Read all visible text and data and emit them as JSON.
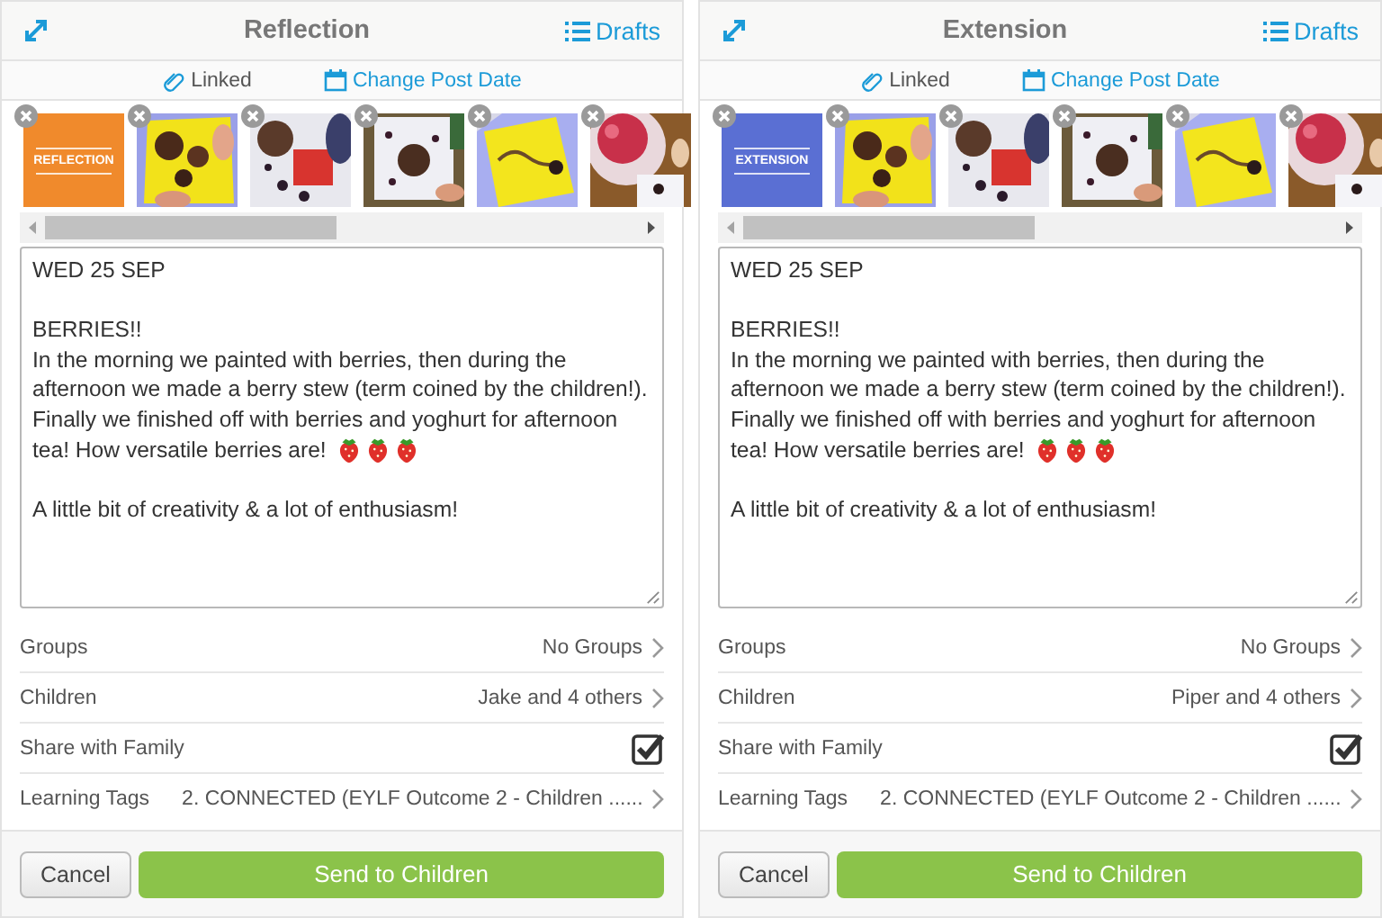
{
  "panels": [
    {
      "header": {
        "title": "Reflection",
        "drafts": "Drafts"
      },
      "toolbar": {
        "linked": "Linked",
        "change_date": "Change Post Date"
      },
      "thumbnails": [
        {
          "kind": "cover",
          "label": "REFLECTION",
          "color": "#f08a2c"
        },
        {
          "kind": "picture"
        },
        {
          "kind": "picture"
        },
        {
          "kind": "picture"
        },
        {
          "kind": "picture"
        },
        {
          "kind": "picture"
        }
      ],
      "body": [
        {
          "kind": "text",
          "text": "WED 25 SEP"
        },
        {
          "kind": "blank"
        },
        {
          "kind": "text",
          "text": "BERRIES!!"
        },
        {
          "kind": "text",
          "text": "In the morning we painted with berries, then during the"
        },
        {
          "kind": "text",
          "text": "afternoon we made a berry stew (term coined by the children!)."
        },
        {
          "kind": "text",
          "text": "Finally we finished off with berries and yoghurt for afternoon"
        },
        {
          "kind": "text",
          "text": "tea! How versatile berries are!",
          "icons": [
            {
              "kind": "strawberry"
            },
            {
              "kind": "strawberry"
            },
            {
              "kind": "strawberry"
            }
          ]
        },
        {
          "kind": "blank"
        },
        {
          "kind": "text",
          "text": "A little bit of creativity & a lot of enthusiasm!"
        }
      ],
      "rows": [
        {
          "kind": "link",
          "label": "Groups",
          "value": "No Groups"
        },
        {
          "kind": "link",
          "label": "Children",
          "value": "Jake and 4 others"
        },
        {
          "kind": "checkbox",
          "label": "Share with Family",
          "checked": true
        },
        {
          "kind": "link",
          "label": "Learning Tags",
          "value": "2. CONNECTED (EYLF Outcome 2 - Children ......"
        }
      ],
      "buttons": {
        "cancel": "Cancel",
        "send": "Send to Children"
      }
    },
    {
      "header": {
        "title": "Extension",
        "drafts": "Drafts"
      },
      "toolbar": {
        "linked": "Linked",
        "change_date": "Change Post Date"
      },
      "thumbnails": [
        {
          "kind": "cover",
          "label": "EXTENSION",
          "color": "#5a6fd3"
        },
        {
          "kind": "picture"
        },
        {
          "kind": "picture"
        },
        {
          "kind": "picture"
        },
        {
          "kind": "picture"
        },
        {
          "kind": "picture"
        }
      ],
      "body": [
        {
          "kind": "text",
          "text": "WED 25 SEP"
        },
        {
          "kind": "blank"
        },
        {
          "kind": "text",
          "text": "BERRIES!!"
        },
        {
          "kind": "text",
          "text": "In the morning we painted with berries, then during the"
        },
        {
          "kind": "text",
          "text": "afternoon we made a berry stew (term coined by the children!)."
        },
        {
          "kind": "text",
          "text": "Finally we finished off with berries and yoghurt for afternoon"
        },
        {
          "kind": "text",
          "text": "tea! How versatile berries are!",
          "icons": [
            {
              "kind": "strawberry"
            },
            {
              "kind": "strawberry"
            },
            {
              "kind": "strawberry"
            }
          ]
        },
        {
          "kind": "blank"
        },
        {
          "kind": "text",
          "text": "A little bit of creativity & a lot of enthusiasm!"
        }
      ],
      "rows": [
        {
          "kind": "link",
          "label": "Groups",
          "value": "No Groups"
        },
        {
          "kind": "link",
          "label": "Children",
          "value": "Piper and 4 others"
        },
        {
          "kind": "checkbox",
          "label": "Share with Family",
          "checked": true
        },
        {
          "kind": "link",
          "label": "Learning Tags",
          "value": "2. CONNECTED (EYLF Outcome 2 - Children ......"
        }
      ],
      "buttons": {
        "cancel": "Cancel",
        "send": "Send to Children"
      }
    }
  ]
}
